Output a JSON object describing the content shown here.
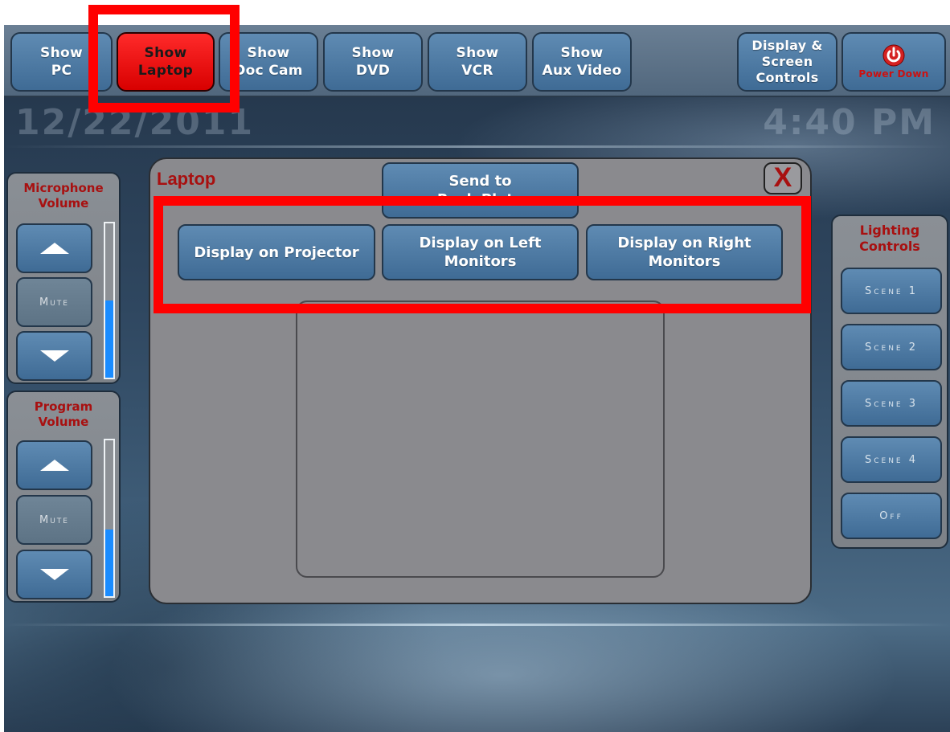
{
  "nav": {
    "items": [
      {
        "line1": "Show",
        "line2": "PC"
      },
      {
        "line1": "Show",
        "line2": "Laptop"
      },
      {
        "line1": "Show",
        "line2": "Doc Cam"
      },
      {
        "line1": "Show",
        "line2": "DVD"
      },
      {
        "line1": "Show",
        "line2": "VCR"
      },
      {
        "line1": "Show",
        "line2": "Aux Video"
      }
    ],
    "display": {
      "line1": "Display &",
      "line2": "Screen",
      "line3": "Controls"
    },
    "power": {
      "label": "Power Down",
      "icon": "power-icon"
    }
  },
  "clock": {
    "date": "12/22/2011",
    "time": "4:40 PM"
  },
  "microphone": {
    "title_line1": "Microphone",
    "title_line2": "Volume",
    "mute": "Mute",
    "level": 0.5
  },
  "program": {
    "title_line1": "Program",
    "title_line2": "Volume",
    "mute": "Mute",
    "level": 0.43
  },
  "dialog": {
    "title": "Laptop",
    "close": "X",
    "send": {
      "line1": "Send to",
      "line2": "Rack Plate"
    },
    "projector": "Display on Projector",
    "left": {
      "line1": "Display on Left",
      "line2": "Monitors"
    },
    "right": {
      "line1": "Display on Right",
      "line2": "Monitors"
    }
  },
  "lighting": {
    "title_line1": "Lighting",
    "title_line2": "Controls",
    "scenes": [
      "Scene 1",
      "Scene 2",
      "Scene 3",
      "Scene 4",
      "Off"
    ]
  },
  "colors": {
    "highlight": "#ff0000",
    "active": "#ff2020",
    "accent": "#4a76a0",
    "title_red": "#a81010",
    "meter": "#1a8cff"
  }
}
